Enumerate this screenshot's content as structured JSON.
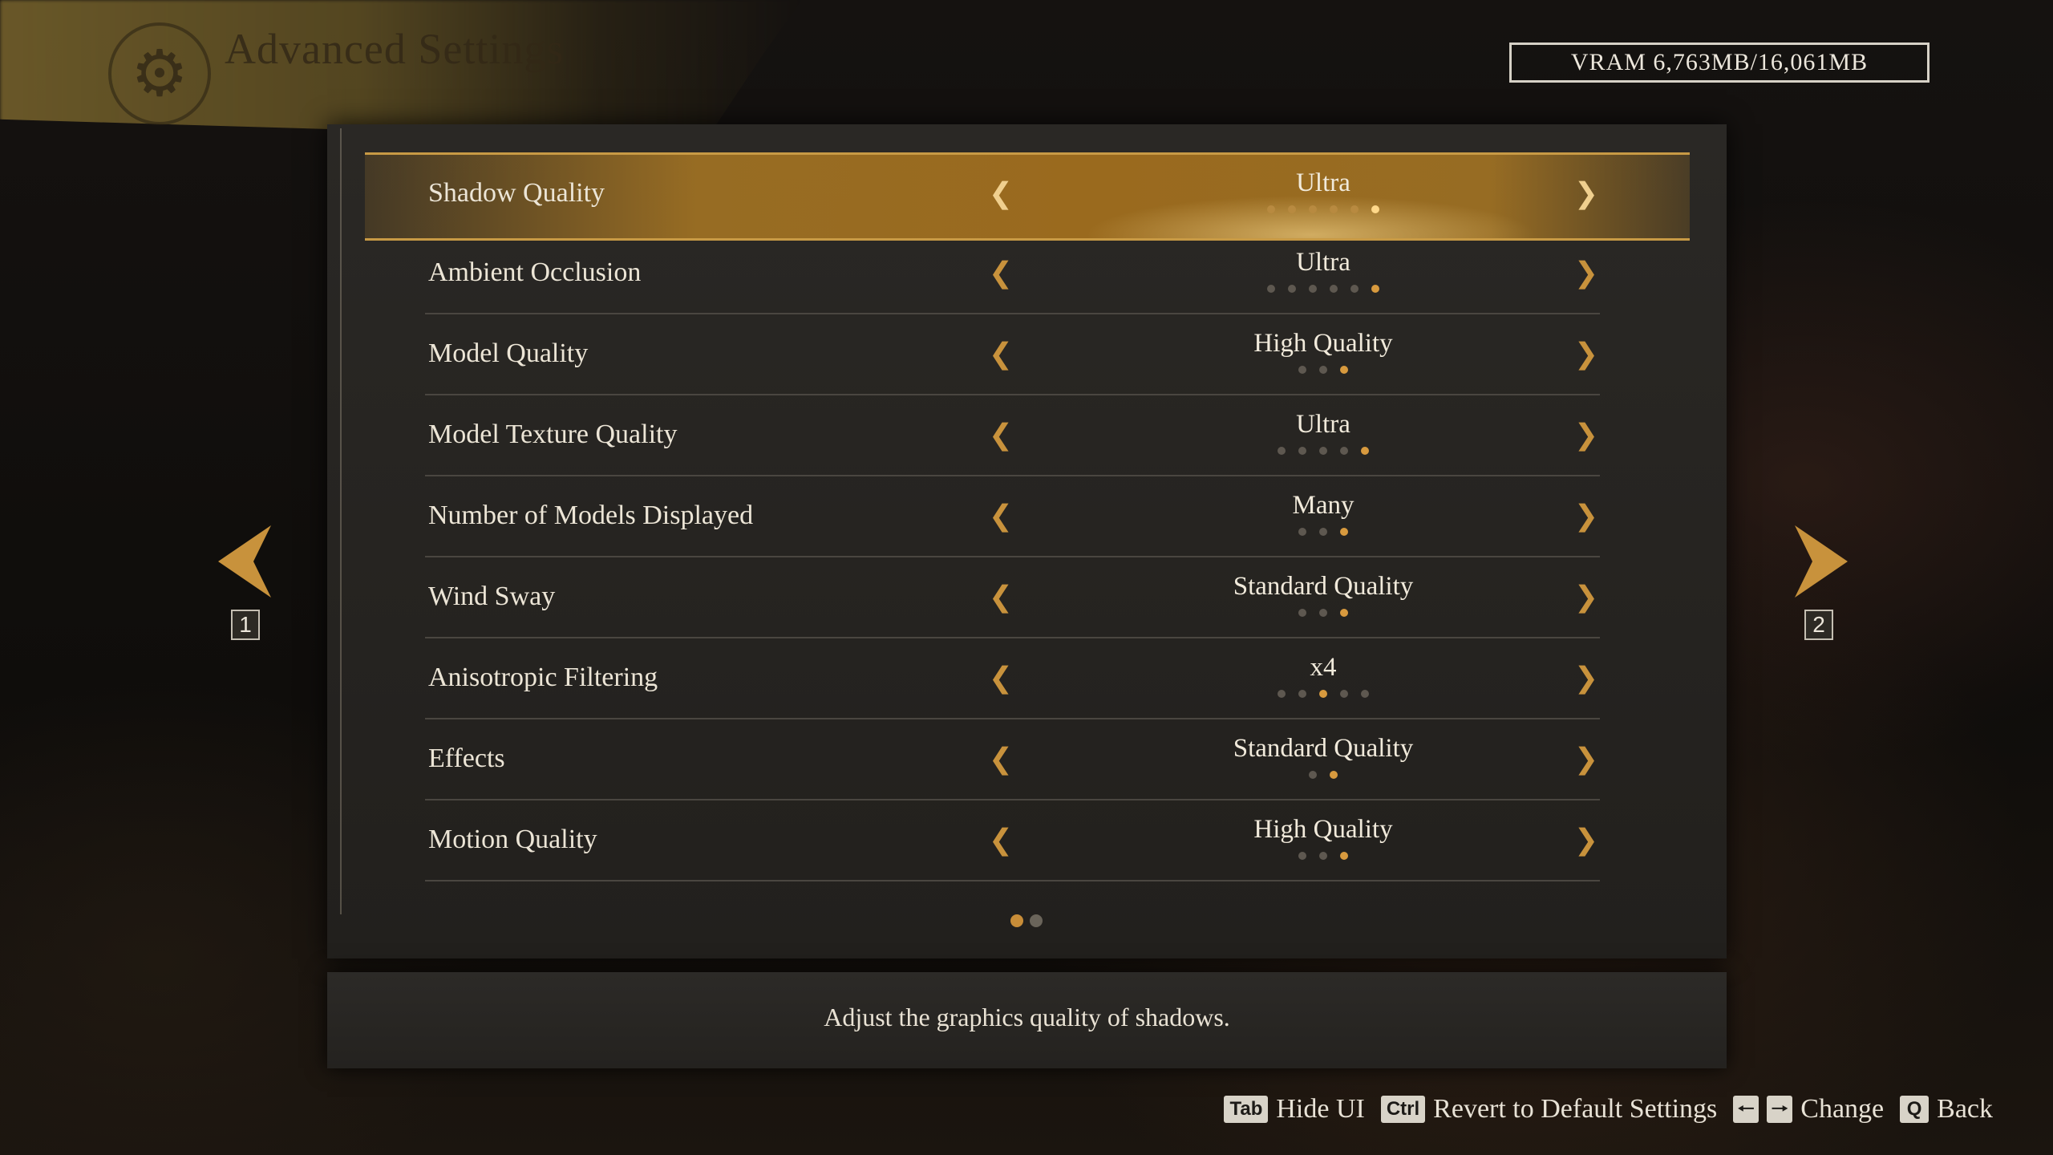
{
  "header": {
    "title": "Advanced Settings",
    "icon": "gear-icon",
    "vram": "VRAM 6,763MB/16,061MB"
  },
  "settings": [
    {
      "label": "Shadow Quality",
      "value": "Ultra",
      "levels": 6,
      "selected_level": 6
    },
    {
      "label": "Ambient Occlusion",
      "value": "Ultra",
      "levels": 6,
      "selected_level": 6
    },
    {
      "label": "Model Quality",
      "value": "High Quality",
      "levels": 3,
      "selected_level": 3
    },
    {
      "label": "Model Texture Quality",
      "value": "Ultra",
      "levels": 5,
      "selected_level": 5
    },
    {
      "label": "Number of Models Displayed",
      "value": "Many",
      "levels": 3,
      "selected_level": 3
    },
    {
      "label": "Wind Sway",
      "value": "Standard Quality",
      "levels": 3,
      "selected_level": 3
    },
    {
      "label": "Anisotropic Filtering",
      "value": "x4",
      "levels": 5,
      "selected_level": 3
    },
    {
      "label": "Effects",
      "value": "Standard Quality",
      "levels": 2,
      "selected_level": 2
    },
    {
      "label": "Motion Quality",
      "value": "High Quality",
      "levels": 3,
      "selected_level": 3
    }
  ],
  "selected_row": 0,
  "pagination": {
    "current_page": 1,
    "total_pages": 2,
    "prev_key": "1",
    "next_key": "2"
  },
  "description": "Adjust the graphics quality of shadows.",
  "footer": {
    "hide_ui_key": "Tab",
    "hide_ui_label": "Hide UI",
    "revert_key": "Ctrl",
    "revert_label": "Revert to Default Settings",
    "change_label": "Change",
    "back_key": "Q",
    "back_label": "Back"
  },
  "colors": {
    "accent": "#c8923c",
    "highlight": "#9a6a1e",
    "dot_on": "#d89a3e"
  }
}
